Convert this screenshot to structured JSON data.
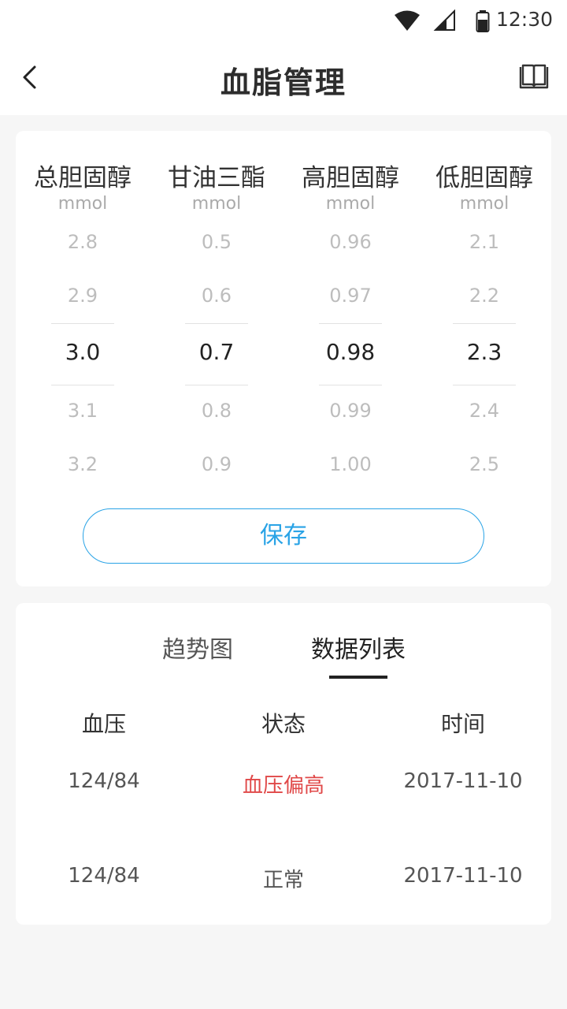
{
  "status_bar": {
    "time": "12:30"
  },
  "nav": {
    "title": "血脂管理"
  },
  "picker": {
    "columns": [
      {
        "title": "总胆固醇",
        "unit": "mmol",
        "values": [
          "2.8",
          "2.9",
          "3.0",
          "3.1",
          "3.2"
        ],
        "selected": "3.0"
      },
      {
        "title": "甘油三酯",
        "unit": "mmol",
        "values": [
          "0.5",
          "0.6",
          "0.7",
          "0.8",
          "0.9"
        ],
        "selected": "0.7"
      },
      {
        "title": "高胆固醇",
        "unit": "mmol",
        "values": [
          "0.96",
          "0.97",
          "0.98",
          "0.99",
          "1.00"
        ],
        "selected": "0.98"
      },
      {
        "title": "低胆固醇",
        "unit": "mmol",
        "values": [
          "2.1",
          "2.2",
          "2.3",
          "2.4",
          "2.5"
        ],
        "selected": "2.3"
      }
    ],
    "save_label": "保存"
  },
  "tabs": {
    "trend": "趋势图",
    "list": "数据列表",
    "active": "数据列表"
  },
  "table": {
    "headers": [
      "血压",
      "状态",
      "时间"
    ],
    "rows": [
      {
        "bp": "124/84",
        "status": "血压偏高",
        "time": "2017-11-10",
        "status_color": "#e04848"
      },
      {
        "bp": "124/84",
        "status": "正常",
        "time": "2017-11-10",
        "status_color": "#555555"
      }
    ]
  },
  "colors": {
    "accent": "#29a3e6",
    "warning": "#e04848"
  }
}
